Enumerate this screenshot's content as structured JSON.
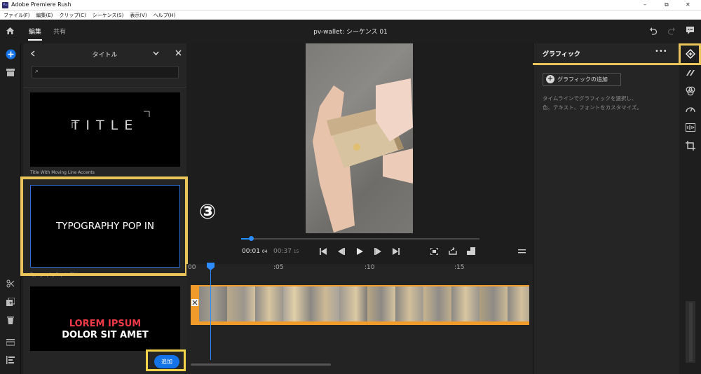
{
  "window": {
    "app_icon": "Ru",
    "title": "Adobe Premiere Rush",
    "minimize": "–",
    "restore": "⧉",
    "close": "✕"
  },
  "menu": [
    "ファイル(F)",
    "編集(E)",
    "クリップ(C)",
    "シーケンス(S)",
    "表示(V)",
    "ヘルプ(H)"
  ],
  "top": {
    "tab_edit": "編集",
    "tab_share": "共有",
    "doc_title": "pv-wallet: シーケンス 01"
  },
  "left_panel": {
    "title": "タイトル",
    "search_placeholder": "",
    "items": [
      {
        "label": "Title With Moving Line Accents",
        "thumb_text": "TITLE"
      },
      {
        "label": "Typography Pop In Title",
        "thumb_text": "TYPOGRAPHY POP IN"
      },
      {
        "label": "",
        "thumb_text_line1": "LOREM IPSUM",
        "thumb_text_line2": "DOLOR SIT AMET"
      }
    ],
    "add_button": "追加"
  },
  "annotation": {
    "step": "③",
    "highlight_color": "#e8c45a"
  },
  "player": {
    "current_time": "00:01",
    "current_frames": "04",
    "total_time": "00:37",
    "total_frames": "15",
    "progress_fraction": 0.04
  },
  "timeline": {
    "ruler_ticks": [
      "00",
      ":05",
      ":10",
      ":15"
    ],
    "clip_color": "#f09b2a",
    "playhead_color": "#2d8cff"
  },
  "right_panel": {
    "title": "グラフィック",
    "more": "•••",
    "add_graphic": "グラフィックの追加",
    "help_line1": "タイムラインでグラフィックを選択し、",
    "help_line2": "色、テキスト、フォントをカスタマイズ。"
  },
  "colors": {
    "accent": "#1473e6",
    "highlight": "#e8c45a"
  }
}
